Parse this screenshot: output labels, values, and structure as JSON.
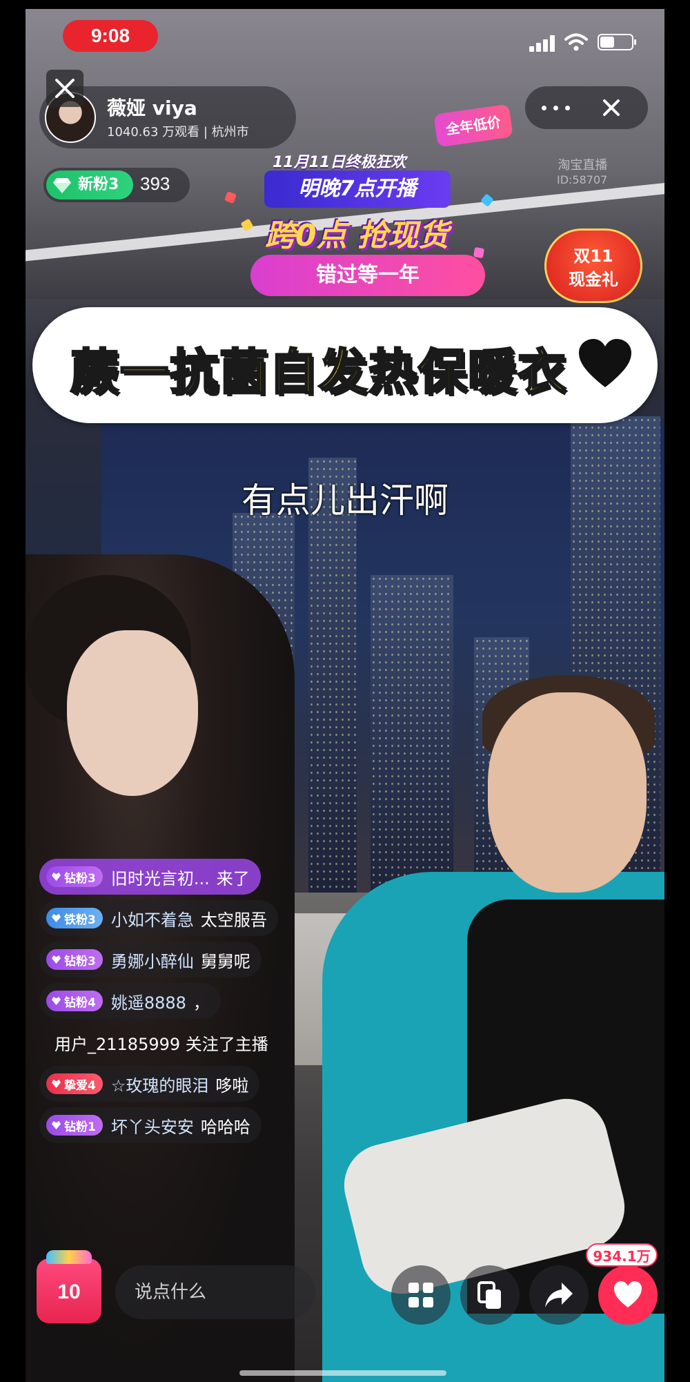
{
  "status_bar": {
    "time": "9:08",
    "battery_level": 0.45
  },
  "host": {
    "name": "薇娅 viya",
    "stats": "1040.63 万观看 | 杭州市"
  },
  "fans": {
    "badge_label": "新粉3",
    "count": "393"
  },
  "top_tag": "全年低价",
  "watermark": {
    "brand": "淘宝直播",
    "id": "ID:58707"
  },
  "promo": {
    "line1": "11月11日终极狂欢",
    "line2": "明晚7点开播",
    "line3": "跨0点 抢现货",
    "line4": "错过等一年"
  },
  "gift_badge": {
    "line1": "双11",
    "line2": "现金礼"
  },
  "product_title": "蕨一抗菌自发热保暖衣",
  "caption": "有点儿出汗啊",
  "chat": [
    {
      "level": "钻粉3",
      "level_color": "purple",
      "user": "旧时光言初...",
      "message": "来了",
      "highlight": true
    },
    {
      "level": "铁粉3",
      "level_color": "blue",
      "user": "小如不着急",
      "message": "太空服吾",
      "highlight": false
    },
    {
      "level": "钻粉3",
      "level_color": "purple",
      "user": "勇娜小醉仙",
      "message": "舅舅呢",
      "highlight": false
    },
    {
      "level": "钻粉4",
      "level_color": "purple",
      "user": "姚遥8888",
      "message": "，",
      "highlight": false
    },
    {
      "level": "",
      "level_color": "",
      "user": "",
      "message": "用户_21185999 关注了主播",
      "highlight": false
    },
    {
      "level": "挚爱4",
      "level_color": "red",
      "user": "☆玫瑰的眼泪",
      "message": "哆啦",
      "highlight": false
    },
    {
      "level": "钻粉1",
      "level_color": "purple",
      "user": "坏丫头安安",
      "message": "哈哈哈",
      "highlight": false
    }
  ],
  "bottom": {
    "shop_count": "10",
    "comment_placeholder": "说点什么",
    "like_count": "934.1万"
  },
  "colors": {
    "accent": "#ff2d55",
    "fan_green": "#1ec26a",
    "product_yellow": "#f7d21a",
    "time_red": "#e9242d"
  }
}
